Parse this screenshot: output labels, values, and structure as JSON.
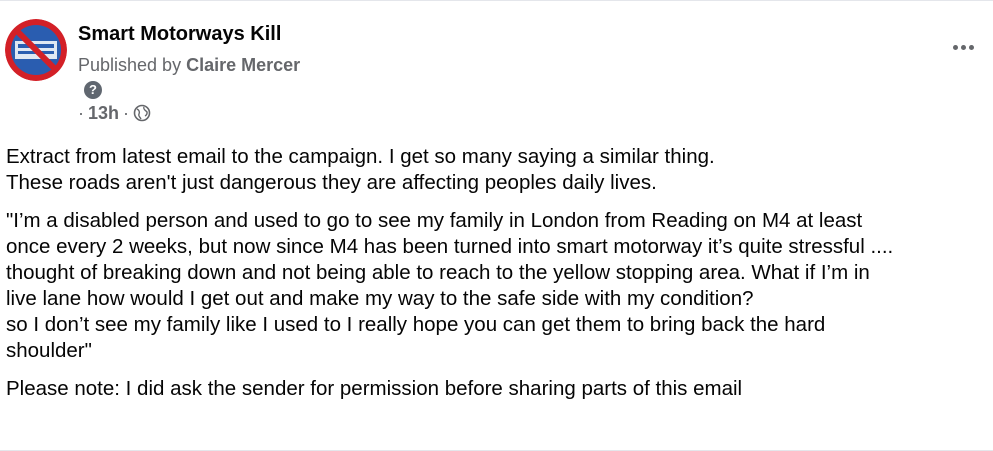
{
  "post": {
    "page_name": "Smart Motorways Kill",
    "published_prefix": "Published by ",
    "author": "Claire Mercer",
    "help_symbol": "?",
    "dot": "·",
    "time": "13h",
    "privacy_icon": "globe-icon",
    "more_icon": "more-options-icon",
    "avatar_icon": "no-smart-motorway-logo",
    "colors": {
      "avatar_ring": "#d32027",
      "avatar_fill": "#2a5db0",
      "secondary_text": "#65676b"
    },
    "paragraphs": [
      "Extract from latest email to the campaign. I get so many saying a similar thing.\nThese roads aren't just dangerous they are affecting peoples daily lives.",
      "\"I’m a disabled person and used to go to see my family in London from Reading on M4 at least\nonce every 2 weeks, but now since M4 has been turned into smart motorway it’s quite stressful ....\nthought of breaking down and not being able to reach to the yellow stopping area. What if I’m in\nlive lane how would I get out and make my way to the safe side with my condition?\nso I don’t see my family like I used to I really hope you can get them to bring back the hard\nshoulder\"",
      "Please note: I did ask the sender for permission before sharing parts of this email"
    ]
  }
}
